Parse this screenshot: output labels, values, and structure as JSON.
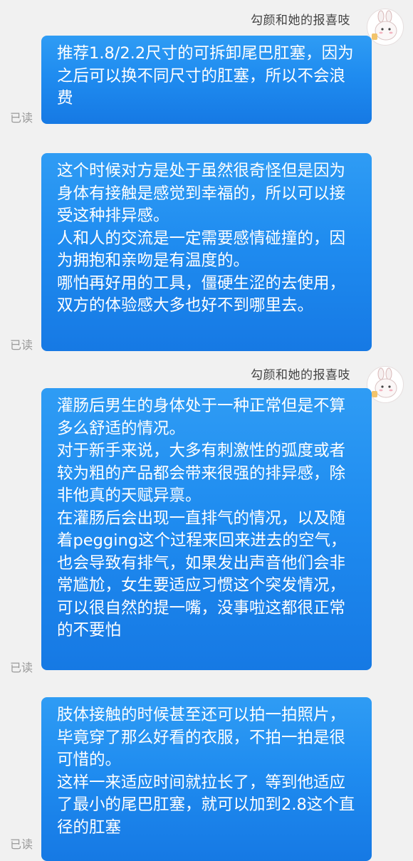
{
  "messages": [
    {
      "sender": "勾颜和她的报喜吱",
      "text": "推荐1.8/2.2尺寸的可拆卸尾巴肛塞，因为之后可以换不同尺寸的肛塞，所以不会浪费",
      "status": "已读"
    },
    {
      "sender": "",
      "text": "这个时候对方是处于虽然很奇怪但是因为身体有接触是感觉到幸福的，所以可以接受这种排异感。\n人和人的交流是一定需要感情碰撞的，因为拥抱和亲吻是有温度的。\n哪怕再好用的工具，僵硬生涩的去使用，双方的体验感大多也好不到哪里去。",
      "status": "已读"
    },
    {
      "sender": "勾颜和她的报喜吱",
      "text": "灌肠后男生的身体处于一种正常但是不算多么舒适的情况。\n对于新手来说，大多有刺激性的弧度或者较为粗的产品都会带来很强的排异感，除非他真的天赋异禀。\n在灌肠后会出现一直排气的情况，以及随着pegging这个过程来回来进去的空气，也会导致有排气，如果发出声音他们会非常尴尬，女生要适应习惯这个突发情况，可以很自然的提一嘴，没事啦这都很正常的不要怕",
      "status": "已读"
    },
    {
      "sender": "",
      "text": "肢体接触的时候甚至还可以拍一拍照片，毕竟穿了那么好看的衣服，不拍一拍是很可惜的。\n这样一来适应时间就拉长了，等到他适应了最小的尾巴肛塞，就可以加到2.8这个直径的肛塞",
      "status": "已读"
    }
  ],
  "colors": {
    "bubble": "#1f8cf0",
    "background": "#f1f1f1",
    "read_status": "#9a9a9a"
  },
  "icons": {
    "avatar": "sheep-avatar-icon"
  }
}
